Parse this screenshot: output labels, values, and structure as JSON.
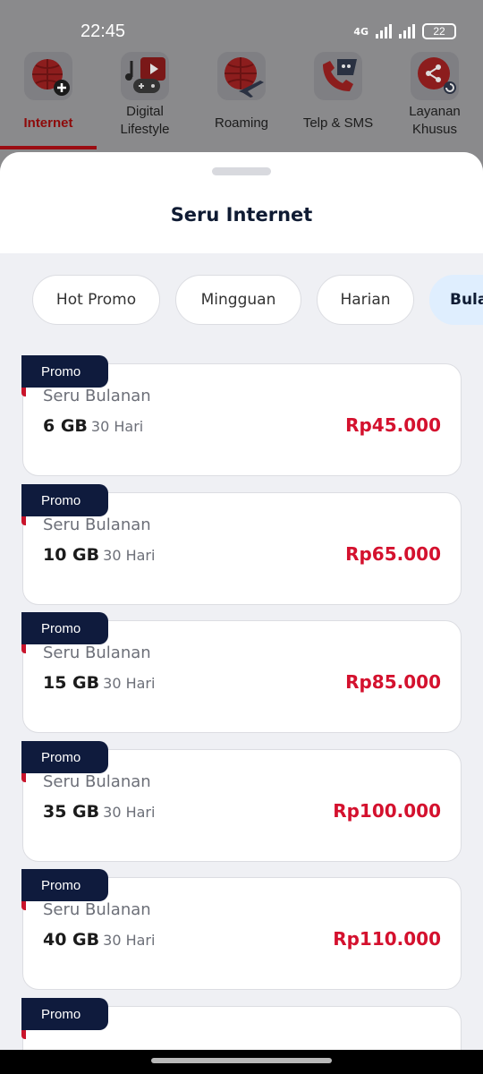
{
  "status": {
    "time": "22:45",
    "network": "4G",
    "battery": "22"
  },
  "categories": [
    {
      "label": "Internet",
      "active": true,
      "icon": "globe-plus-icon"
    },
    {
      "label": "Digital\nLifestyle",
      "active": false,
      "icon": "media-gamepad-icon"
    },
    {
      "label": "Roaming",
      "active": false,
      "icon": "globe-plane-icon"
    },
    {
      "label": "Telp & SMS",
      "active": false,
      "icon": "phone-sms-icon"
    },
    {
      "label": "Layanan\nKhusus",
      "active": false,
      "icon": "special-service-icon"
    }
  ],
  "sheet": {
    "title": "Seru Internet"
  },
  "filters": [
    "Hot Promo",
    "Mingguan",
    "Harian",
    "Bula"
  ],
  "active_filter": "Bula",
  "packages": [
    {
      "tag": "Promo",
      "name": "Seru Bulanan",
      "quota": "6 GB",
      "duration": "30 Hari",
      "price": "Rp45.000"
    },
    {
      "tag": "Promo",
      "name": "Seru Bulanan",
      "quota": "10 GB",
      "duration": "30 Hari",
      "price": "Rp65.000"
    },
    {
      "tag": "Promo",
      "name": "Seru Bulanan",
      "quota": "15 GB",
      "duration": "30 Hari",
      "price": "Rp85.000"
    },
    {
      "tag": "Promo",
      "name": "Seru Bulanan",
      "quota": "35 GB",
      "duration": "30 Hari",
      "price": "Rp100.000"
    },
    {
      "tag": "Promo",
      "name": "Seru Bulanan",
      "quota": "40 GB",
      "duration": "30 Hari",
      "price": "Rp110.000"
    },
    {
      "tag": "Promo",
      "name": "",
      "quota": "",
      "duration": "",
      "price": ""
    }
  ],
  "colors": {
    "brand_red": "#d4112e",
    "navy": "#0f1b3d",
    "active_chip": "#dfeefe"
  }
}
